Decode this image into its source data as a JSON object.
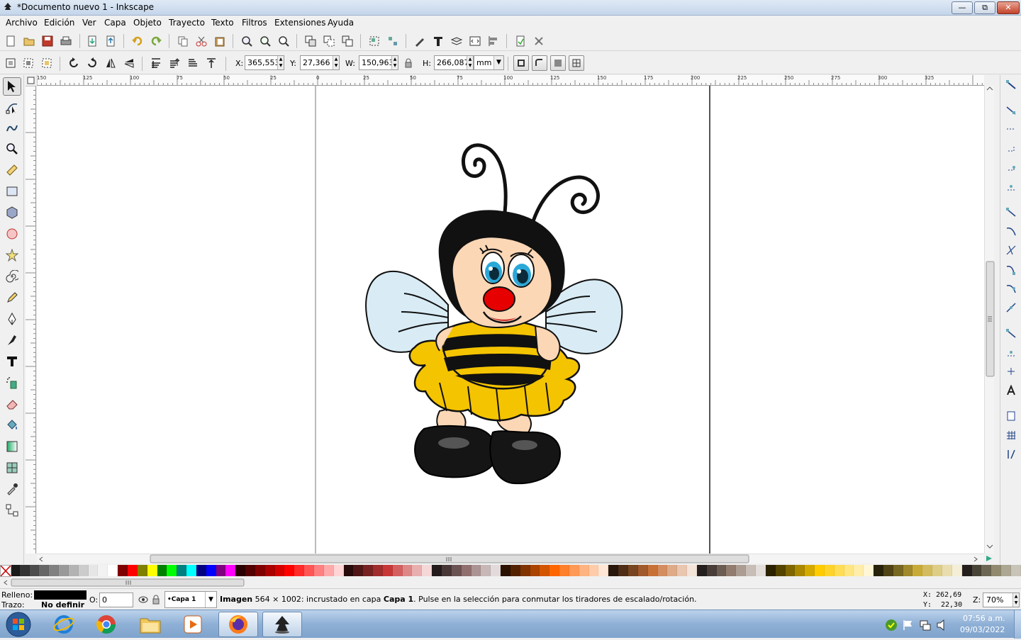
{
  "window": {
    "title": "*Documento nuevo 1 - Inkscape",
    "minimize": "—",
    "restore": "⧉",
    "close": "✕"
  },
  "menu": [
    "Archivo",
    "Edición",
    "Ver",
    "Capa",
    "Objeto",
    "Trayecto",
    "Texto",
    "Filtros",
    "Extensiones",
    "Ayuda"
  ],
  "selection": {
    "x_label": "X:",
    "x_value": "365,553",
    "y_label": "Y:",
    "y_value": "27,366",
    "w_label": "W:",
    "w_value": "150,963",
    "h_label": "H:",
    "h_value": "266,087",
    "unit": "mm"
  },
  "ruler": {
    "labels": [
      "150",
      "125",
      "100",
      "75",
      "50",
      "25",
      "0",
      "25",
      "50",
      "75",
      "100",
      "125",
      "150",
      "175",
      "200",
      "225",
      "250",
      "275",
      "300",
      "325"
    ]
  },
  "status": {
    "fill_label": "Relleno:",
    "stroke_label": "Trazo:",
    "stroke_value": "No definir",
    "opacity_label": "O:",
    "opacity_value": "0",
    "layer": "•Capa 1",
    "message_bold1": "Imagen",
    "message_part1": " 564 × 1002: incrustado en capa ",
    "message_bold2": "Capa 1",
    "message_part2": ". Pulse en la selección para conmutar los tiradores de escalado/rotación.",
    "cursor_x_label": "X:",
    "cursor_x": "262,69",
    "cursor_y_label": "Y:",
    "cursor_y": "22,30",
    "zoom_label": "Z:",
    "zoom": "70%"
  },
  "taskbar": {
    "time": "07:56 a.m.",
    "date": "09/03/2022"
  },
  "colors": {
    "bee_yellow": "#f5c400",
    "bee_black": "#111111",
    "bee_skin": "#fcd7b6",
    "bee_wing": "#d9ecf6",
    "bee_nose": "#e60000",
    "bee_eye": "#2aa8d8"
  }
}
